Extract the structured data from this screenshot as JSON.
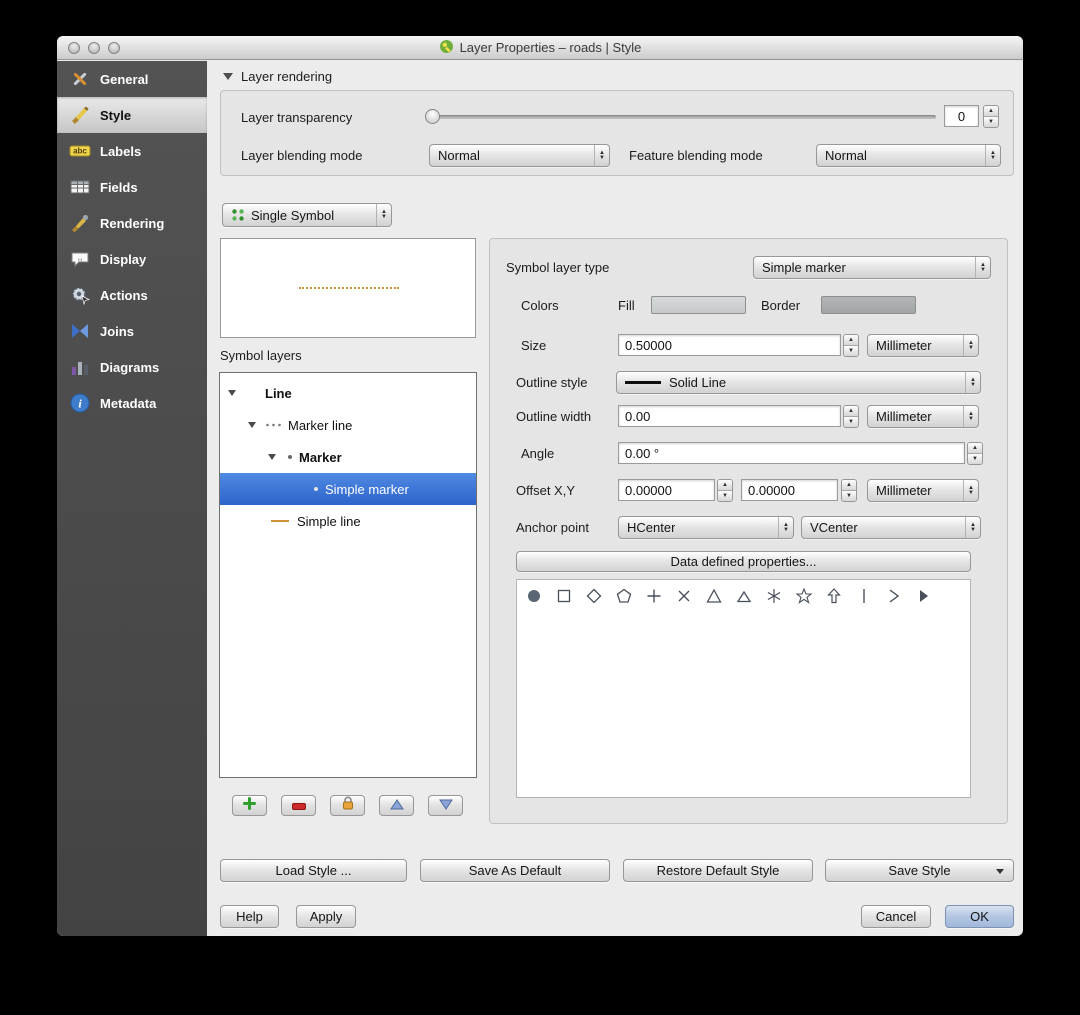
{
  "window": {
    "title": "Layer Properties – roads | Style"
  },
  "sidebar": {
    "items": [
      {
        "label": "General"
      },
      {
        "label": "Style"
      },
      {
        "label": "Labels"
      },
      {
        "label": "Fields"
      },
      {
        "label": "Rendering"
      },
      {
        "label": "Display"
      },
      {
        "label": "Actions"
      },
      {
        "label": "Joins"
      },
      {
        "label": "Diagrams"
      },
      {
        "label": "Metadata"
      }
    ]
  },
  "layer_rendering": {
    "title": "Layer rendering",
    "transparency": {
      "label": "Layer transparency",
      "value": "0"
    },
    "layer_blending": {
      "label": "Layer blending mode",
      "value": "Normal"
    },
    "feature_blending": {
      "label": "Feature blending mode",
      "value": "Normal"
    }
  },
  "renderer": {
    "value": "Single Symbol"
  },
  "symbol_layers": {
    "label": "Symbol layers",
    "items": [
      {
        "label": "Line"
      },
      {
        "label": "Marker line"
      },
      {
        "label": "Marker"
      },
      {
        "label": "Simple marker"
      },
      {
        "label": "Simple line"
      }
    ]
  },
  "properties": {
    "symbol_layer_type": {
      "label": "Symbol layer type",
      "value": "Simple marker"
    },
    "colors": {
      "label": "Colors",
      "fill_label": "Fill",
      "border_label": "Border",
      "fill_color": "#d7dadb",
      "border_color": "#b3b6b7"
    },
    "size": {
      "label": "Size",
      "value": "0.50000",
      "unit": "Millimeter"
    },
    "outline_style": {
      "label": "Outline style",
      "value": "Solid Line"
    },
    "outline_width": {
      "label": "Outline width",
      "value": "0.00",
      "unit": "Millimeter"
    },
    "angle": {
      "label": "Angle",
      "value": "0.00 °"
    },
    "offset": {
      "label": "Offset X,Y",
      "x": "0.00000",
      "y": "0.00000",
      "unit": "Millimeter"
    },
    "anchor": {
      "label": "Anchor point",
      "h": "HCenter",
      "v": "VCenter"
    },
    "data_defined": "Data defined properties...",
    "shape_names": [
      "circle",
      "square",
      "diamond",
      "pentagon",
      "cross",
      "cross2",
      "triangle",
      "equilateral-triangle",
      "star",
      "regular-star",
      "arrow",
      "line",
      "arrowhead",
      "filled-arrowhead"
    ]
  },
  "footer": {
    "load_style": "Load Style ...",
    "save_as_default": "Save As Default",
    "restore_default_style": "Restore Default Style",
    "save_style": "Save Style",
    "help": "Help",
    "apply": "Apply",
    "cancel": "Cancel",
    "ok": "OK"
  },
  "colors": {
    "selection_blue": "#3b74d6",
    "sidebar_bg": "#4a4a4a",
    "symbol_line_orange": "#cf9436"
  }
}
